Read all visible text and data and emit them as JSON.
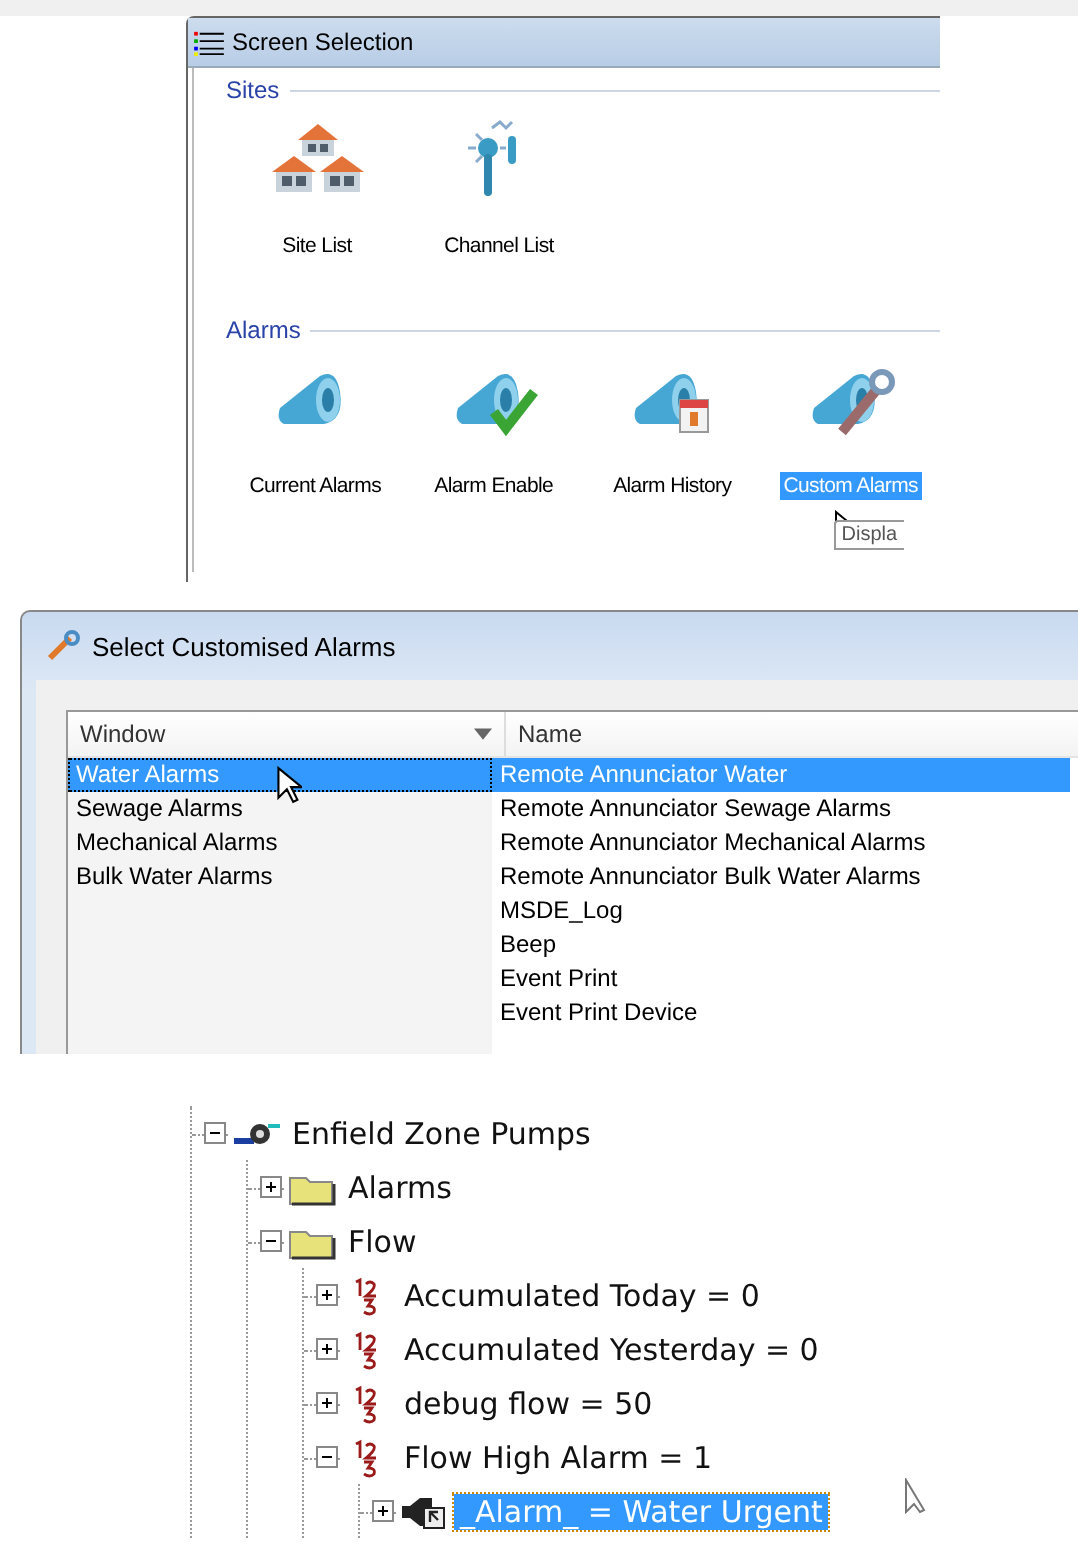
{
  "screen_selection": {
    "window": {
      "title": "Screen Selection"
    },
    "groups": [
      {
        "heading": "Sites",
        "items": [
          {
            "kind": "houses",
            "label": "Site List",
            "selected": false
          },
          {
            "kind": "channel",
            "label": "Channel List",
            "selected": false
          }
        ]
      },
      {
        "heading": "Alarms",
        "items": [
          {
            "kind": "horn",
            "label": "Current Alarms",
            "selected": false
          },
          {
            "kind": "enable",
            "label": "Alarm Enable",
            "selected": false
          },
          {
            "kind": "history",
            "label": "Alarm History",
            "selected": false
          },
          {
            "kind": "custom",
            "label": "Custom Alarms",
            "selected": true
          }
        ]
      }
    ],
    "tooltip": "Displa"
  },
  "customised_alarms": {
    "window": {
      "title": "Select Customised Alarms"
    },
    "columns": [
      "Window",
      "Name"
    ],
    "windows": [
      {
        "label": "Water Alarms",
        "selected": true
      },
      {
        "label": "Sewage Alarms",
        "selected": false
      },
      {
        "label": "Mechanical Alarms",
        "selected": false
      },
      {
        "label": "Bulk Water Alarms",
        "selected": false
      }
    ],
    "names": [
      {
        "label": "Remote Annunciator Water",
        "selected": true
      },
      {
        "label": "Remote Annunciator Sewage Alarms",
        "selected": false
      },
      {
        "label": "Remote Annunciator Mechanical Alarms",
        "selected": false
      },
      {
        "label": "Remote Annunciator Bulk Water Alarms",
        "selected": false
      },
      {
        "label": "MSDE_Log",
        "selected": false
      },
      {
        "label": "Beep",
        "selected": false
      },
      {
        "label": "Event Print",
        "selected": false
      },
      {
        "label": "Event Print Device",
        "selected": false
      }
    ]
  },
  "tree": {
    "nodes": [
      {
        "kind": "pump",
        "label": "Enfield Zone Pumps",
        "expanded": true,
        "selected": false,
        "children": [
          {
            "kind": "folder",
            "label": "Alarms",
            "expanded": false,
            "selected": false
          },
          {
            "kind": "folder",
            "label": "Flow",
            "expanded": true,
            "selected": false,
            "children": [
              {
                "kind": "number",
                "label": "Accumulated Today = 0",
                "expanded": false,
                "selected": false
              },
              {
                "kind": "number",
                "label": "Accumulated Yesterday = 0",
                "expanded": false,
                "selected": false
              },
              {
                "kind": "number",
                "label": "debug flow = 50",
                "expanded": false,
                "selected": false
              },
              {
                "kind": "number",
                "label": "Flow High Alarm = 1",
                "expanded": true,
                "selected": false,
                "children": [
                  {
                    "kind": "alarm",
                    "label": "_Alarm_ = Water Urgent",
                    "expanded": false,
                    "selected": true
                  }
                ]
              }
            ]
          }
        ]
      }
    ]
  }
}
